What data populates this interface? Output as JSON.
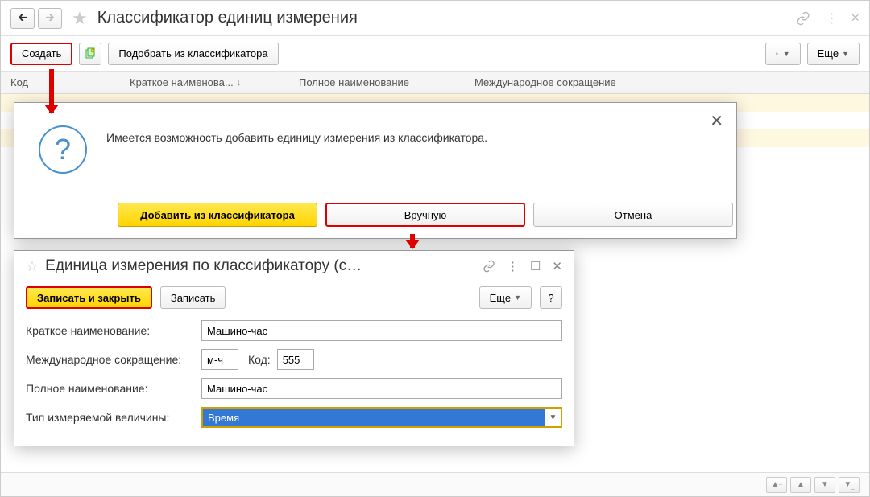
{
  "header": {
    "title": "Классификатор единиц измерения"
  },
  "toolbar": {
    "create_label": "Создать",
    "pick_label": "Подобрать из классификатора",
    "more_label": "Еще"
  },
  "grid": {
    "col_code": "Код",
    "col_short": "Краткое наименова...",
    "col_full": "Полное наименование",
    "col_intl": "Международное сокращение"
  },
  "dialog_choice": {
    "message": "Имеется возможность добавить единицу измерения из классификатора.",
    "btn_add": "Добавить из классификатора",
    "btn_manual": "Вручную",
    "btn_cancel": "Отмена"
  },
  "dialog_form": {
    "title": "Единица измерения по классификатору (с…",
    "btn_save_close": "Записать и закрыть",
    "btn_save": "Записать",
    "btn_more": "Еще",
    "lbl_short": "Краткое наименование:",
    "lbl_intl": "Международное сокращение:",
    "lbl_code": "Код:",
    "lbl_full": "Полное наименование:",
    "lbl_type": "Тип измеряемой величины:",
    "val_short": "Машино-час",
    "val_intl": "м-ч",
    "val_code": "555",
    "val_full": "Машино-час",
    "val_type": "Время"
  }
}
